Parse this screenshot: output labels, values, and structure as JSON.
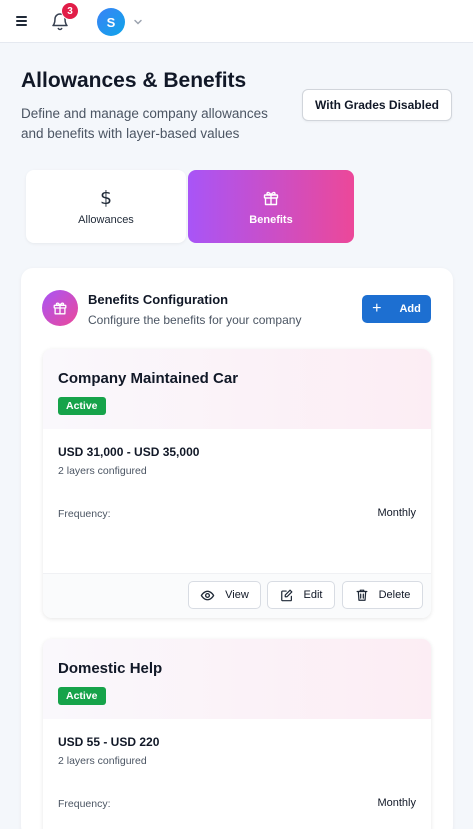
{
  "topbar": {
    "notification_count": "3",
    "avatar_initial": "S"
  },
  "header": {
    "title": "Allowances & Benefits",
    "subtitle": "Define and manage company allowances and benefits with layer-based values",
    "grades_button": "With Grades Disabled"
  },
  "tabs": [
    {
      "label": "Allowances",
      "icon": "dollar-icon",
      "active": false
    },
    {
      "label": "Benefits",
      "icon": "gift-icon",
      "active": true
    }
  ],
  "config": {
    "title": "Benefits Configuration",
    "subtitle": "Configure the benefits for your company",
    "add_label": "Add"
  },
  "benefits": [
    {
      "name": "Company Maintained Car",
      "status": "Active",
      "range": "USD 31,000 - USD 35,000",
      "layers": "2 layers configured",
      "frequency_label": "Frequency:",
      "frequency_value": "Monthly",
      "actions": {
        "view": "View",
        "edit": "Edit",
        "delete": "Delete"
      }
    },
    {
      "name": "Domestic Help",
      "status": "Active",
      "range": "USD 55 - USD 220",
      "layers": "2 layers configured",
      "frequency_label": "Frequency:",
      "frequency_value": "Monthly"
    }
  ],
  "colors": {
    "accent_gradient_start": "#a855f7",
    "accent_gradient_end": "#ec4899",
    "primary_button": "#1d6fd1",
    "status_active": "#16a34a",
    "notification_badge": "#e11d48"
  }
}
